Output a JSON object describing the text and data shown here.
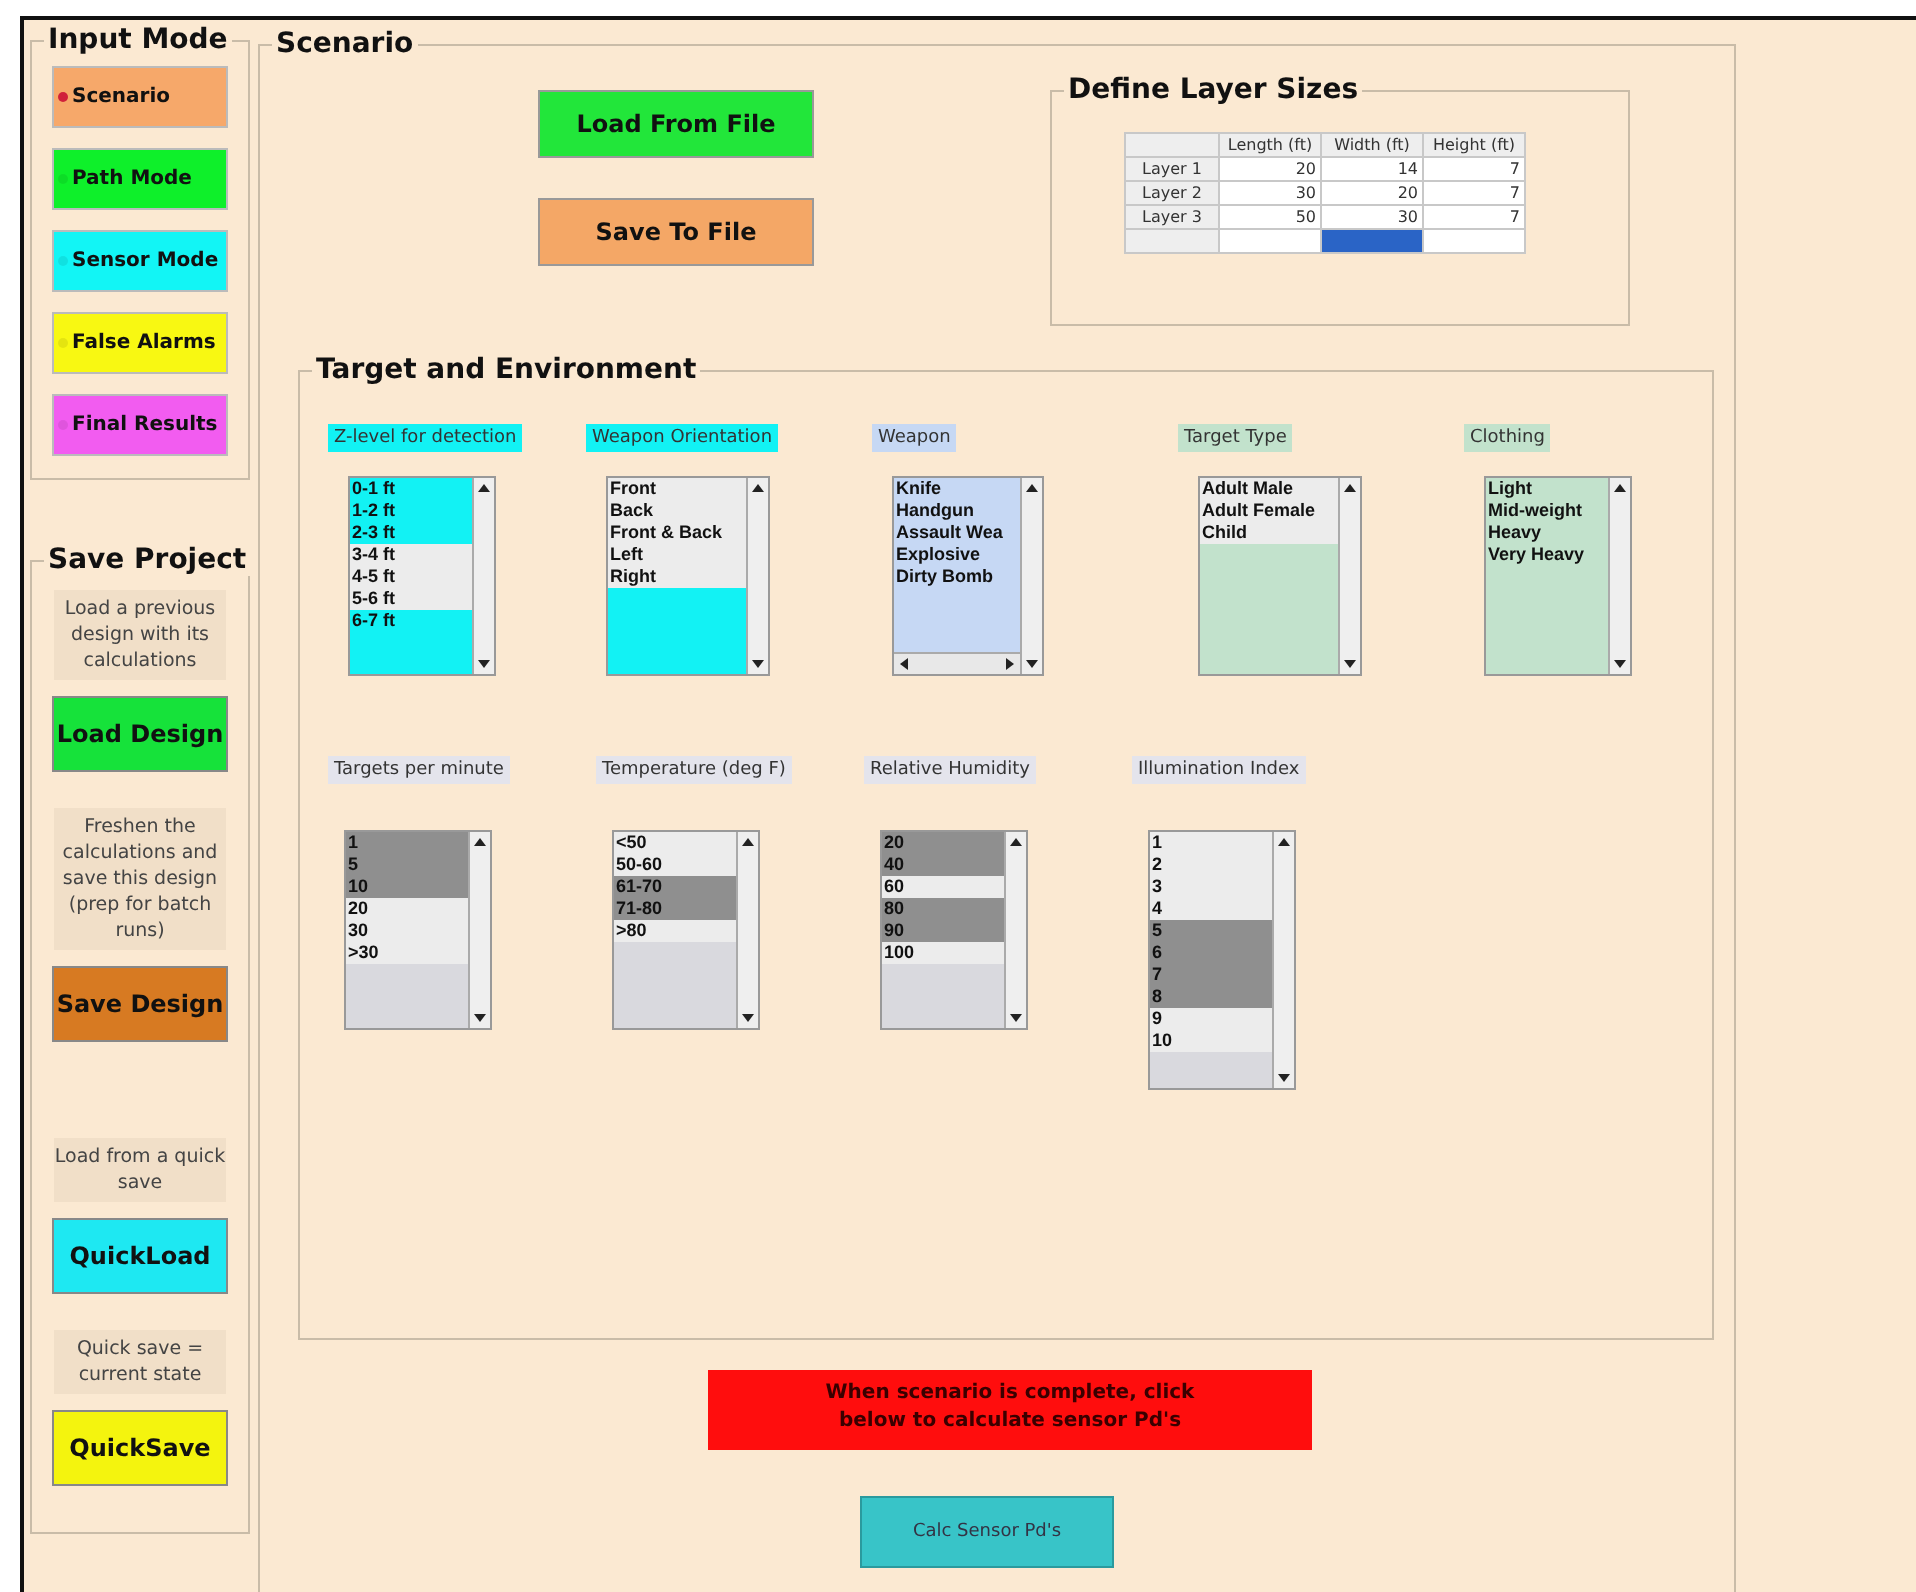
{
  "input_mode": {
    "title": "Input Mode",
    "options": [
      {
        "label": "Scenario",
        "color": "#f6a86a",
        "selected": true
      },
      {
        "label": "Path Mode",
        "color": "#0ef02a",
        "selected": false
      },
      {
        "label": "Sensor Mode",
        "color": "#12f5f5",
        "selected": false
      },
      {
        "label": "False Alarms",
        "color": "#f8f812",
        "selected": false
      },
      {
        "label": "Final Results",
        "color": "#f25cf0",
        "selected": false
      }
    ]
  },
  "save_project": {
    "title": "Save Project",
    "items": [
      {
        "note": "Load a previous design with its calculations",
        "button": "Load Design",
        "color": "#16e23a"
      },
      {
        "note": "Freshen the calculations and save this design (prep for batch runs)",
        "button": "Save Design",
        "color": "#d77a22"
      },
      {
        "note": "Load from a quick save",
        "button": "QuickLoad",
        "color": "#1ee8f2"
      },
      {
        "note": "Quick save = current state",
        "button": "QuickSave",
        "color": "#f4f40e"
      }
    ]
  },
  "scenario": {
    "title": "Scenario",
    "file_buttons": [
      {
        "label": "Load From File",
        "color": "#22e63a"
      },
      {
        "label": "Save To File",
        "color": "#f4a766"
      }
    ],
    "layer_sizes": {
      "title": "Define Layer Sizes",
      "columns": [
        "Length (ft)",
        "Width (ft)",
        "Height (ft)"
      ],
      "rows": [
        {
          "label": "Layer 1",
          "values": [
            "20",
            "14",
            "7"
          ]
        },
        {
          "label": "Layer 2",
          "values": [
            "30",
            "20",
            "7"
          ]
        },
        {
          "label": "Layer 3",
          "values": [
            "50",
            "30",
            "7"
          ]
        }
      ],
      "new_row_cells": [
        {
          "selected": false
        },
        {
          "selected": true
        },
        {
          "selected": false
        }
      ]
    },
    "target_environment": {
      "title": "Target and Environment",
      "lists": [
        {
          "label": "Z-level for detection",
          "kind": "colored",
          "color": "#12f2f4",
          "hscroll": false,
          "items": [
            {
              "text": "0-1 ft",
              "selected": true
            },
            {
              "text": "1-2 ft",
              "selected": true
            },
            {
              "text": "2-3 ft",
              "selected": true
            },
            {
              "text": "3-4 ft",
              "selected": false
            },
            {
              "text": "4-5 ft",
              "selected": false
            },
            {
              "text": "5-6 ft",
              "selected": false
            },
            {
              "text": "6-7 ft",
              "selected": true
            }
          ]
        },
        {
          "label": "Weapon Orientation",
          "kind": "colored",
          "color": "#12f2f4",
          "hscroll": false,
          "items": [
            {
              "text": "Front",
              "selected": false
            },
            {
              "text": "Back",
              "selected": false
            },
            {
              "text": "Front & Back",
              "selected": false
            },
            {
              "text": "Left",
              "selected": false
            },
            {
              "text": "Right",
              "selected": false
            }
          ]
        },
        {
          "label": "Weapon",
          "kind": "colored",
          "color": "#c6d8f4",
          "hscroll": true,
          "items": [
            {
              "text": "Knife",
              "selected": true
            },
            {
              "text": "Handgun",
              "selected": true
            },
            {
              "text": "Assault Wea",
              "selected": true
            },
            {
              "text": "Explosive",
              "selected": true
            },
            {
              "text": "Dirty Bomb",
              "selected": true
            }
          ]
        },
        {
          "label": "Target Type",
          "kind": "colored",
          "color": "#c2e2cc",
          "hscroll": false,
          "items": [
            {
              "text": "Adult Male",
              "selected": false
            },
            {
              "text": "Adult Female",
              "selected": false
            },
            {
              "text": "Child",
              "selected": false
            }
          ]
        },
        {
          "label": "Clothing",
          "kind": "colored",
          "color": "#c2e2cc",
          "hscroll": false,
          "items": [
            {
              "text": "Light",
              "selected": true
            },
            {
              "text": "Mid-weight",
              "selected": true
            },
            {
              "text": "Heavy",
              "selected": true
            },
            {
              "text": "Very Heavy",
              "selected": true
            }
          ]
        },
        {
          "label": "Targets per minute",
          "kind": "plain",
          "color": "#8f8f8f",
          "hscroll": false,
          "items": [
            {
              "text": "1",
              "selected": true
            },
            {
              "text": "5",
              "selected": true
            },
            {
              "text": "10",
              "selected": true
            },
            {
              "text": "20",
              "selected": false
            },
            {
              "text": "30",
              "selected": false
            },
            {
              "text": ">30",
              "selected": false
            }
          ]
        },
        {
          "label": "Temperature (deg F)",
          "kind": "plain",
          "color": "#8f8f8f",
          "hscroll": false,
          "items": [
            {
              "text": "<50",
              "selected": false
            },
            {
              "text": "50-60",
              "selected": false
            },
            {
              "text": "61-70",
              "selected": true
            },
            {
              "text": "71-80",
              "selected": true
            },
            {
              "text": ">80",
              "selected": false
            }
          ]
        },
        {
          "label": "Relative Humidity",
          "kind": "plain",
          "color": "#8f8f8f",
          "hscroll": false,
          "items": [
            {
              "text": "20",
              "selected": true
            },
            {
              "text": "40",
              "selected": true
            },
            {
              "text": "60",
              "selected": false
            },
            {
              "text": "80",
              "selected": true
            },
            {
              "text": "90",
              "selected": true
            },
            {
              "text": "100",
              "selected": false
            }
          ]
        },
        {
          "label": "Illumination Index",
          "kind": "plain",
          "color": "#8f8f8f",
          "hscroll": false,
          "items": [
            {
              "text": "1",
              "selected": false
            },
            {
              "text": "2",
              "selected": false
            },
            {
              "text": "3",
              "selected": false
            },
            {
              "text": "4",
              "selected": false
            },
            {
              "text": "5",
              "selected": true
            },
            {
              "text": "6",
              "selected": true
            },
            {
              "text": "7",
              "selected": true
            },
            {
              "text": "8",
              "selected": true
            },
            {
              "text": "9",
              "selected": false
            },
            {
              "text": "10",
              "selected": false
            }
          ]
        }
      ]
    },
    "notice": "When scenario is complete, click below to calculate sensor Pd's",
    "calc_button": "Calc Sensor Pd's"
  }
}
